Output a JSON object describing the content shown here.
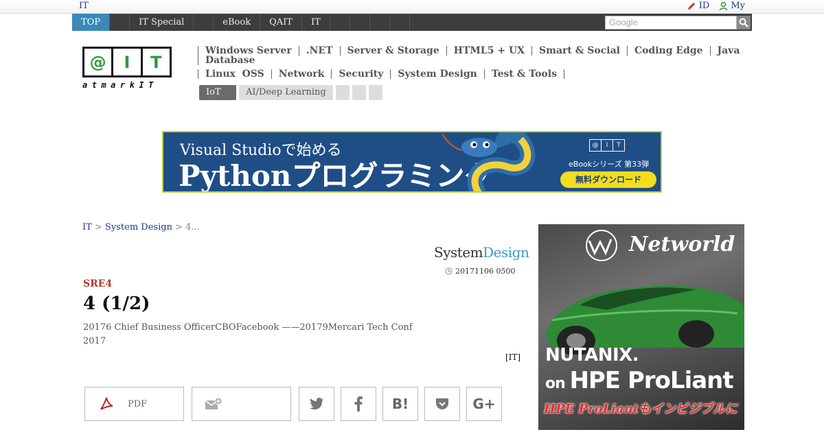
{
  "utilbar": {
    "left_label": "IT",
    "id_label": "ID",
    "my_label": "My"
  },
  "navbar": {
    "tabs": [
      "TOP",
      "",
      "IT Special",
      "",
      "eBook",
      "QAIT",
      "IT",
      "",
      "",
      "",
      ""
    ],
    "active_index": 0,
    "search_placeholder": "Google"
  },
  "logo": {
    "letters": [
      "@",
      "I",
      "T"
    ],
    "subtitle": "atmarkIT"
  },
  "categories": {
    "row1": [
      "Windows Server",
      ".NET",
      "Server & Storage",
      "HTML5 + UX",
      "Smart & Social",
      "Coding Edge",
      "Java",
      "Database"
    ],
    "row2": [
      "Linux  OSS",
      "Network",
      "Security",
      "System Design",
      "Test & Tools"
    ],
    "pills": [
      "IoT",
      "AI/Deep Learning",
      "",
      "",
      ""
    ]
  },
  "banner": {
    "line1": "Visual Studioで始める",
    "line2": "Pythonプログラミング",
    "logo_letters": [
      "@",
      "I",
      "T"
    ],
    "series": "eBookシリーズ 第33弾",
    "button": "無料ダウンロード"
  },
  "breadcrumb": {
    "home": "IT",
    "sep": ">",
    "section": "System Design",
    "current": "4..."
  },
  "section_logo": {
    "part1": "System",
    "part2": "Design"
  },
  "article": {
    "date": "20171106 0500",
    "series": "SRE4",
    "title": "4 (1/2)",
    "lead": "20176 Chief Business OfficerCBOFacebook ——20179Mercari Tech Conf 2017",
    "source": "[IT]"
  },
  "share": {
    "pdf_label": "PDF"
  },
  "side_ad": {
    "brand": "Networld",
    "line1": "NUTANIX.",
    "line2_on": "on ",
    "line2_main": "HPE ProLiant",
    "line3": "HPE ProLiantもインビジブルに"
  },
  "colors": {
    "accent": "#3a89b8",
    "nav_bg": "#3d3d3d",
    "series_red": "#b03a2e",
    "logo_green": "#2e9a3a"
  }
}
